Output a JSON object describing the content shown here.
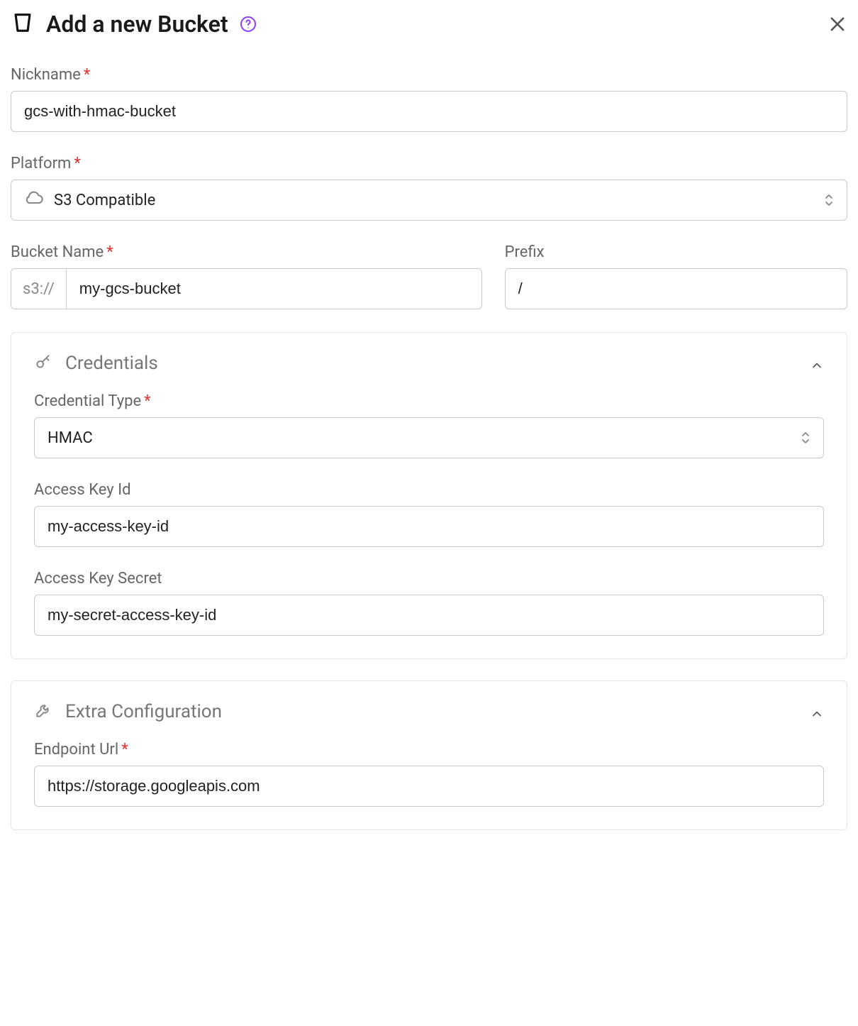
{
  "header": {
    "title": "Add a new Bucket"
  },
  "nickname": {
    "label": "Nickname",
    "value": "gcs-with-hmac-bucket"
  },
  "platform": {
    "label": "Platform",
    "value": "S3 Compatible"
  },
  "bucket_name": {
    "label": "Bucket Name",
    "scheme": "s3://",
    "value": "my-gcs-bucket"
  },
  "prefix": {
    "label": "Prefix",
    "value": "/"
  },
  "credentials": {
    "title": "Credentials",
    "credential_type": {
      "label": "Credential Type",
      "value": "HMAC"
    },
    "access_key_id": {
      "label": "Access Key Id",
      "value": "my-access-key-id"
    },
    "access_key_secret": {
      "label": "Access Key Secret",
      "value": "my-secret-access-key-id"
    }
  },
  "extra": {
    "title": "Extra Configuration",
    "endpoint_url": {
      "label": "Endpoint Url",
      "value": "https://storage.googleapis.com"
    }
  }
}
